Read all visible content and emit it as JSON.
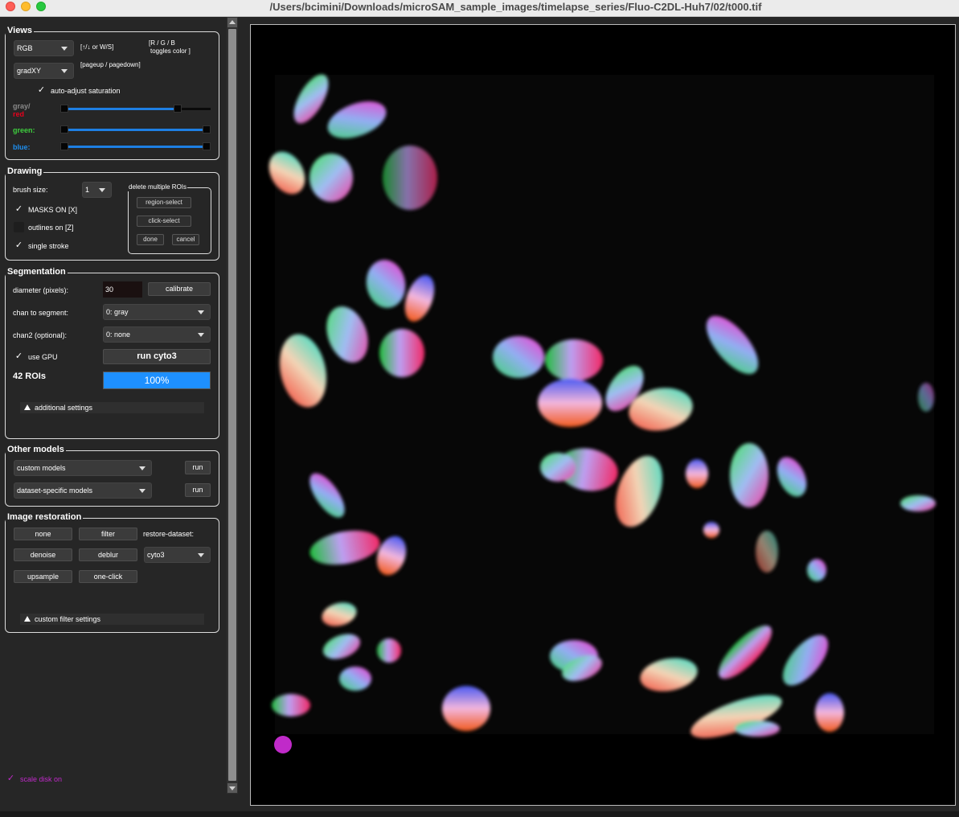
{
  "window": {
    "title": "/Users/bcimini/Downloads/microSAM_sample_images/timelapse_series/Fluo-C2DL-Huh7/02/t000.tif"
  },
  "views": {
    "title": "Views",
    "view_select": "RGB",
    "view_hint": "[↑/↓ or W/S]",
    "color_hint_1": "[R / G / B",
    "color_hint_2": "toggles color ]",
    "mode_select": "gradXY",
    "mode_hint": "[pageup / pagedown]",
    "auto_adjust_label": "auto-adjust saturation",
    "auto_adjust_checked": true,
    "gray_label": "gray/",
    "red_label": "red",
    "green_label": "green:",
    "blue_label": "blue:",
    "colors": {
      "red": "#e8001c",
      "green": "#3ecf3e",
      "blue": "#1e8ff0",
      "slider_fill": "#1e7fe3",
      "accent": "#1e90ff"
    }
  },
  "drawing": {
    "title": "Drawing",
    "brush_label": "brush size:",
    "brush_value": "1",
    "masks_label": "MASKS ON [X]",
    "masks_checked": true,
    "outlines_label": "outlines on [Z]",
    "outlines_checked": false,
    "single_stroke_label": "single stroke",
    "single_stroke_checked": true,
    "delete_group_title": "delete multiple ROIs",
    "region_select": "region-select",
    "click_select": "click-select",
    "done": "done",
    "cancel": "cancel"
  },
  "segmentation": {
    "title": "Segmentation",
    "diameter_label": "diameter (pixels):",
    "diameter_value": "30",
    "calibrate": "calibrate",
    "chan_label": "chan to segment:",
    "chan_value": "0: gray",
    "chan2_label": "chan2 (optional):",
    "chan2_value": "0: none",
    "gpu_label": "use GPU",
    "gpu_checked": true,
    "run_label": "run cyto3",
    "roi_count": "42 ROIs",
    "progress_text": "100%",
    "progress_value": 1.0,
    "additional_settings": "additional settings"
  },
  "other_models": {
    "title": "Other models",
    "custom_models": "custom models",
    "dataset_models": "dataset-specific models",
    "run1": "run",
    "run2": "run"
  },
  "restoration": {
    "title": "Image restoration",
    "none": "none",
    "filter": "filter",
    "restore_dataset_label": "restore-dataset:",
    "denoise": "denoise",
    "deblur": "deblur",
    "dataset_value": "cyto3",
    "upsample": "upsample",
    "one_click": "one-click",
    "custom_filter": "custom filter settings"
  },
  "footer": {
    "scale_disk_label": "scale disk on",
    "scale_disk_checked": true,
    "scale_disk_color": "#c02ac9"
  }
}
